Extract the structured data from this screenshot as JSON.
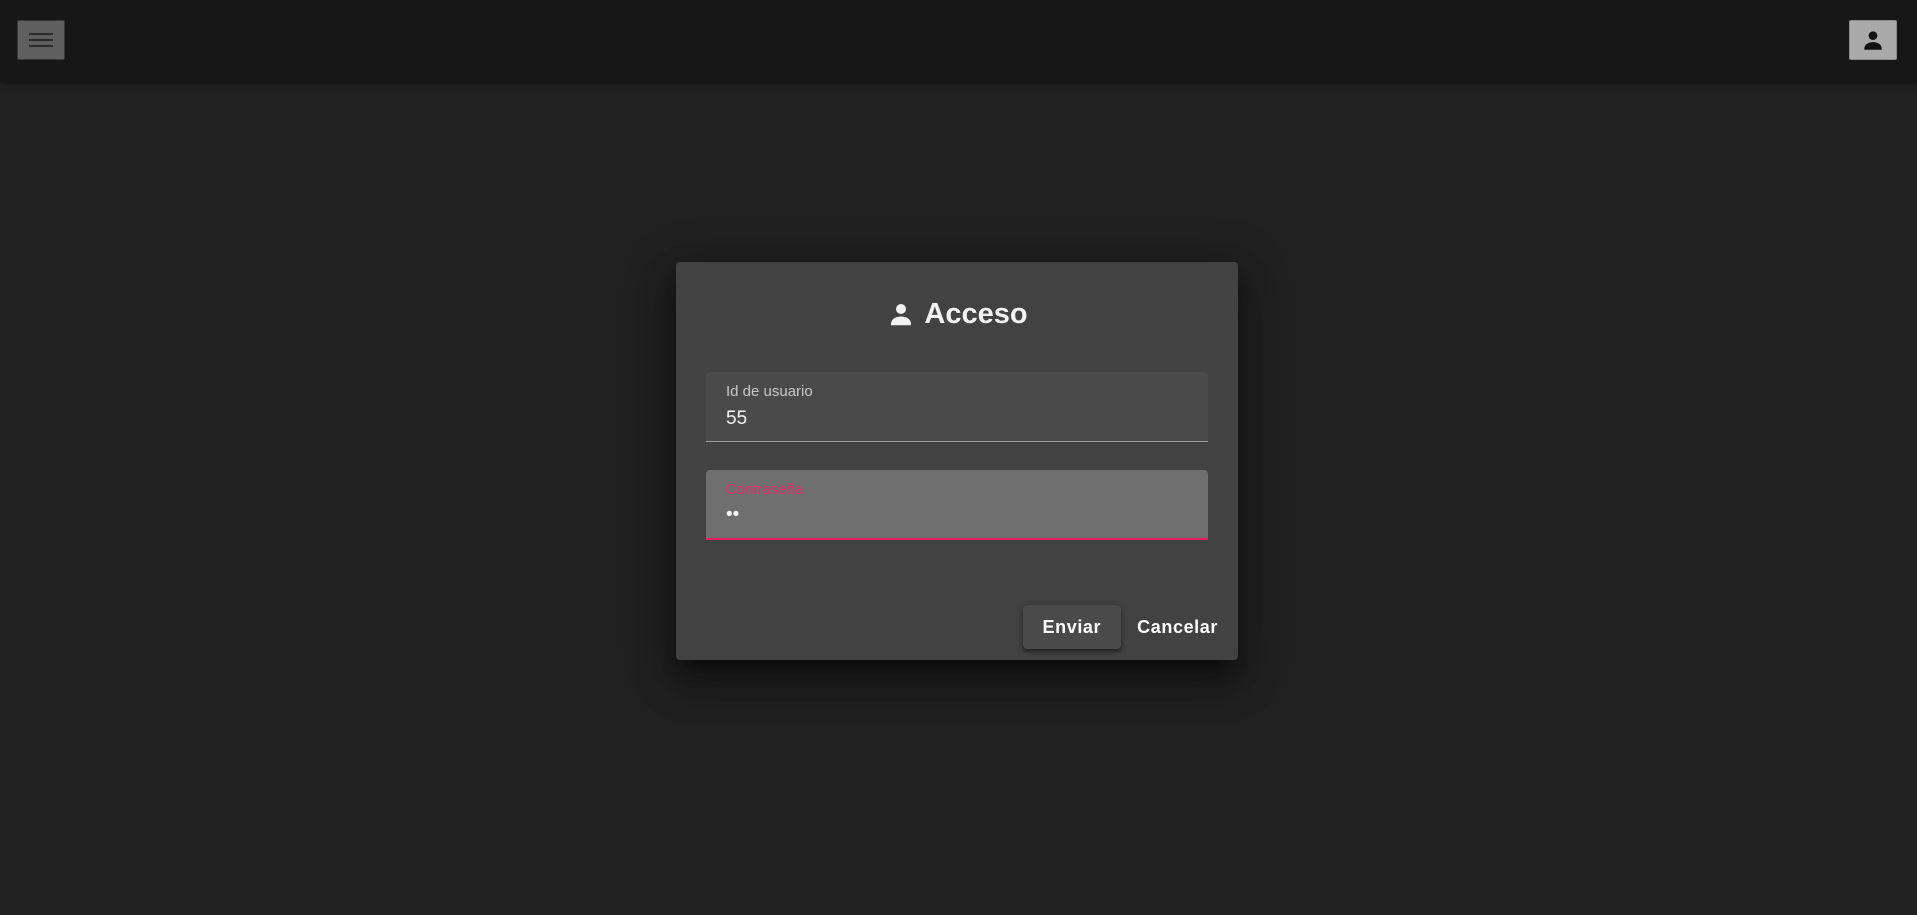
{
  "toolbar": {
    "menu_icon": "menu-icon",
    "account_icon": "person-icon"
  },
  "dialog": {
    "title": "Acceso",
    "title_icon": "person-icon",
    "fields": {
      "user_id": {
        "label": "Id de usuario",
        "value": "55"
      },
      "password": {
        "label": "Contraseña",
        "value": "••"
      }
    },
    "actions": {
      "submit_label": "Enviar",
      "cancel_label": "Cancelar"
    }
  },
  "colors": {
    "background": "#212121",
    "toolbar": "#171717",
    "dialog": "#424242",
    "accent": "#e91e63"
  }
}
